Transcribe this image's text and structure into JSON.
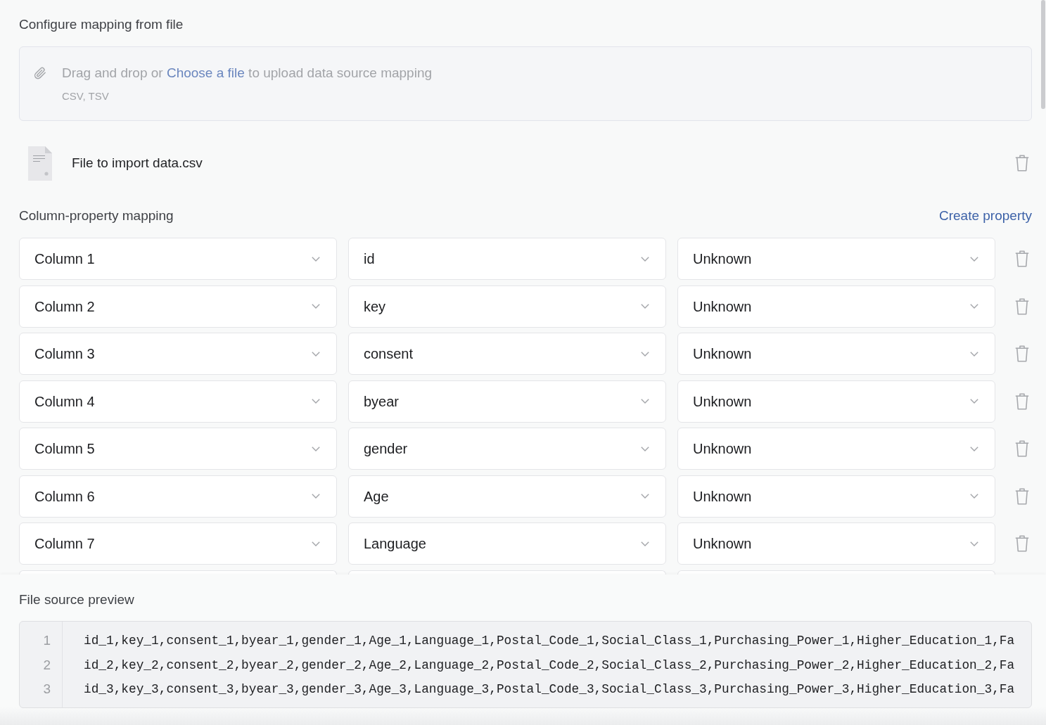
{
  "configure": {
    "title": "Configure mapping from file",
    "dropzone": {
      "prompt_before": "Drag and drop or",
      "link": "Choose a file",
      "prompt_after": "to upload data source mapping",
      "formats": "CSV, TSV"
    },
    "file": {
      "name": "File to import data.csv"
    }
  },
  "mapping": {
    "title": "Column-property mapping",
    "create_link": "Create property",
    "rows": [
      {
        "kind": "full",
        "column": "Column 1",
        "property": "id",
        "type": "Unknown"
      },
      {
        "kind": "full",
        "column": "Column 2",
        "property": "key",
        "type": "Unknown"
      },
      {
        "kind": "full",
        "column": "Column 3",
        "property": "consent",
        "type": "Unknown"
      },
      {
        "kind": "full",
        "column": "Column 4",
        "property": "byear",
        "type": "Unknown"
      },
      {
        "kind": "full",
        "column": "Column 5",
        "property": "gender",
        "type": "Unknown"
      },
      {
        "kind": "full",
        "column": "Column 6",
        "property": "Age",
        "type": "Unknown"
      },
      {
        "kind": "full",
        "column": "Column 7",
        "property": "Language",
        "type": "Unknown"
      },
      {
        "kind": "cut_off"
      }
    ]
  },
  "preview": {
    "title": "File source preview",
    "lines": [
      {
        "number": "1",
        "text": "id_1,key_1,consent_1,byear_1,gender_1,Age_1,Language_1,Postal_Code_1,Social_Class_1,Purchasing_Power_1,Higher_Education_1,Fa"
      },
      {
        "number": "2",
        "text": "id_2,key_2,consent_2,byear_2,gender_2,Age_2,Language_2,Postal_Code_2,Social_Class_2,Purchasing_Power_2,Higher_Education_2,Fa"
      },
      {
        "number": "3",
        "text": "id_3,key_3,consent_3,byear_3,gender_3,Age_3,Language_3,Postal_Code_3,Social_Class_3,Purchasing_Power_3,Higher_Education_3,Fa"
      }
    ]
  }
}
